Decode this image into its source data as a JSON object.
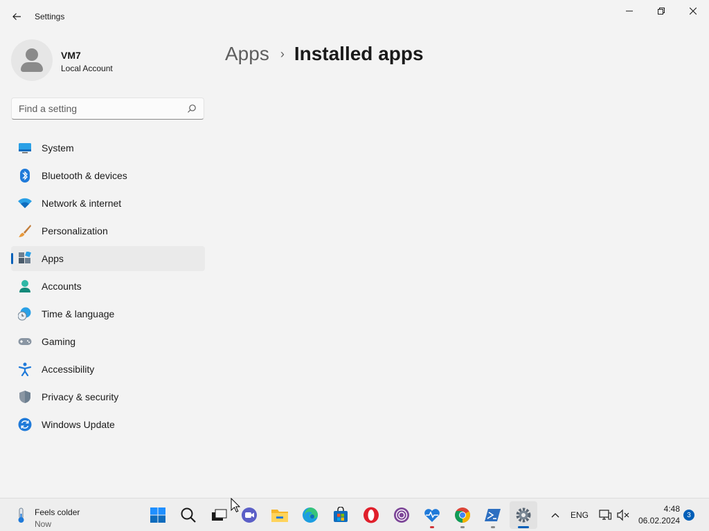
{
  "window": {
    "title": "Settings"
  },
  "profile": {
    "name": "VM7",
    "account_type": "Local Account"
  },
  "search": {
    "placeholder": "Find a setting"
  },
  "nav": {
    "selected": "Apps",
    "items": [
      {
        "label": "System",
        "icon": "system-icon"
      },
      {
        "label": "Bluetooth & devices",
        "icon": "bluetooth-icon"
      },
      {
        "label": "Network & internet",
        "icon": "wifi-icon"
      },
      {
        "label": "Personalization",
        "icon": "brush-icon"
      },
      {
        "label": "Apps",
        "icon": "apps-icon"
      },
      {
        "label": "Accounts",
        "icon": "accounts-icon"
      },
      {
        "label": "Time & language",
        "icon": "clock-globe-icon"
      },
      {
        "label": "Gaming",
        "icon": "gamepad-icon"
      },
      {
        "label": "Accessibility",
        "icon": "accessibility-icon"
      },
      {
        "label": "Privacy & security",
        "icon": "shield-icon"
      },
      {
        "label": "Windows Update",
        "icon": "update-icon"
      }
    ]
  },
  "breadcrumb": {
    "parent": "Apps",
    "separator": "›",
    "current": "Installed apps"
  },
  "taskbar": {
    "weather": {
      "title": "Feels colder",
      "subtitle": "Now"
    },
    "apps": [
      {
        "name": "start",
        "icon": "windows-logo-icon"
      },
      {
        "name": "search",
        "icon": "search-icon"
      },
      {
        "name": "task-view",
        "icon": "task-view-icon"
      },
      {
        "name": "teams",
        "icon": "teams-icon"
      },
      {
        "name": "file-explorer",
        "icon": "folder-icon"
      },
      {
        "name": "edge",
        "icon": "edge-icon"
      },
      {
        "name": "store",
        "icon": "store-icon"
      },
      {
        "name": "opera",
        "icon": "opera-icon"
      },
      {
        "name": "tor",
        "icon": "tor-icon"
      },
      {
        "name": "pc-health",
        "icon": "health-icon"
      },
      {
        "name": "chrome",
        "icon": "chrome-icon"
      },
      {
        "name": "powershell",
        "icon": "powershell-icon"
      },
      {
        "name": "settings",
        "icon": "settings-gear-icon"
      }
    ],
    "tray": {
      "language": "ENG",
      "time": "4:48",
      "date": "06.02.2024",
      "notifications": "3"
    }
  },
  "colors": {
    "accent": "#005fb8",
    "background": "#f3f3f3",
    "selected_nav": "#eaeaea"
  }
}
